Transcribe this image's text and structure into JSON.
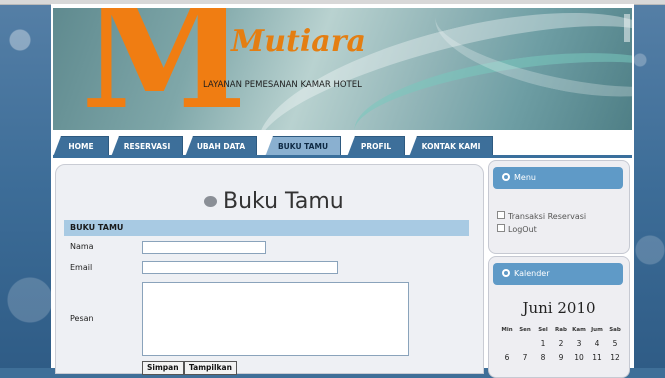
{
  "header": {
    "brand": "Mutiara",
    "logo_letter": "M",
    "tagline": "LAYANAN PEMESANAN KAMAR HOTEL"
  },
  "nav": {
    "tabs": [
      {
        "label": "HOME"
      },
      {
        "label": "RESERVASI"
      },
      {
        "label": "UBAH DATA"
      },
      {
        "label": "BUKU TAMU",
        "active": true
      },
      {
        "label": "PROFIL"
      },
      {
        "label": "KONTAK KAMI"
      }
    ]
  },
  "main": {
    "title": "Buku Tamu",
    "section_header": "BUKU TAMU",
    "form": {
      "nama_label": "Nama",
      "email_label": "Email",
      "pesan_label": "Pesan",
      "nama_value": "",
      "email_value": "",
      "pesan_value": ""
    },
    "buttons": {
      "simpan": "Simpan",
      "tampilkan": "Tampilkan"
    }
  },
  "sidebar": {
    "menu": {
      "title": "Menu",
      "items": [
        "Transaksi Reservasi",
        "LogOut"
      ]
    },
    "calendar": {
      "title": "Kalender",
      "month": "Juni 2010",
      "weekdays": [
        "Min",
        "Sen",
        "Sel",
        "Rab",
        "Kam",
        "Jum",
        "Sab"
      ],
      "weeks": [
        [
          "",
          "",
          "1",
          "2",
          "3",
          "4",
          "5"
        ],
        [
          "6",
          "7",
          "8",
          "9",
          "10",
          "11",
          "12"
        ]
      ]
    }
  },
  "colors": {
    "accent_orange": "#f07d12",
    "nav_blue": "#3d6f9a",
    "section_blue": "#a8cae3",
    "sidebar_head": "#5f9ac7"
  }
}
